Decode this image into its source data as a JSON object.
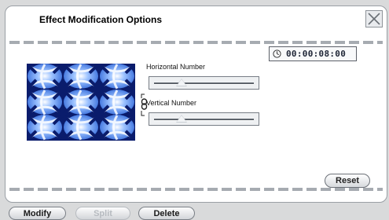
{
  "dialog": {
    "title": "Effect Modification Options",
    "close_icon": "close-icon"
  },
  "timecode": {
    "icon": "clock-icon",
    "value": "00:00:08:00"
  },
  "preview": {
    "description_icon": "tiled-image-preview",
    "rows": 3,
    "cols": 3
  },
  "controls": {
    "horizontal_label": "Horizontal Number",
    "horizontal_value": 0.25,
    "vertical_label": "Vertical Number",
    "vertical_value": 0.25,
    "link_icon": "chain-link-icon"
  },
  "reset_label": "Reset",
  "bottom_bar": {
    "modify_label": "Modify",
    "split_label": "Split",
    "delete_label": "Delete"
  },
  "colors": {
    "preview_blue": "#2a62d6",
    "preview_dark": "#0a1c6c"
  }
}
